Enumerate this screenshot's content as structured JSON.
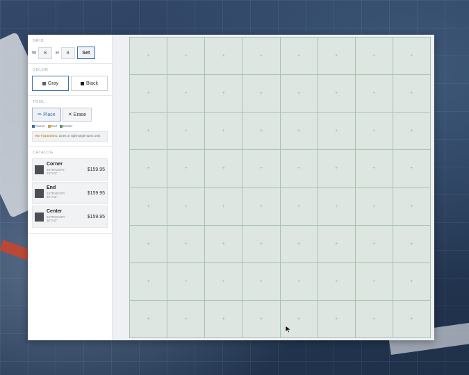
{
  "grid": {
    "section_title": "GRID",
    "w_label": "W",
    "w_value": "8",
    "h_label": "H",
    "h_value": "8",
    "set_label": "Set"
  },
  "color": {
    "section_title": "COLOR",
    "gray_label": "Gray",
    "black_label": "Black",
    "gray_hex": "#5b5f66",
    "black_hex": "#1d1f23",
    "selected": "Gray"
  },
  "tool": {
    "section_title": "TOOL",
    "place_label": "Place",
    "erase_label": "Erase",
    "legend": [
      {
        "label": "Corner",
        "color": "#3b6ea8"
      },
      {
        "label": "End",
        "color": "#c9a24a"
      },
      {
        "label": "Center",
        "color": "#5a8a6a"
      }
    ],
    "note_bold": "No T-junctions.",
    "note_text": " Lines or right-angle turns only."
  },
  "catalog": {
    "section_title": "CATALOG",
    "items": [
      {
        "name": "Corner",
        "sku": "34TRX2GRY",
        "size": "24\"×24\"",
        "price": "$159.95"
      },
      {
        "name": "End",
        "sku": "34TRXEGRY",
        "size": "40\"×32\"",
        "price": "$159.95"
      },
      {
        "name": "Center",
        "sku": "34TRXCGRY",
        "size": "36\"×32\"",
        "price": "$159.95"
      }
    ]
  },
  "board": {
    "rows": 8,
    "cols": 8,
    "cell_symbol": "+",
    "cell_color": "#dde6e0",
    "line_color": "#a9c1b1"
  }
}
